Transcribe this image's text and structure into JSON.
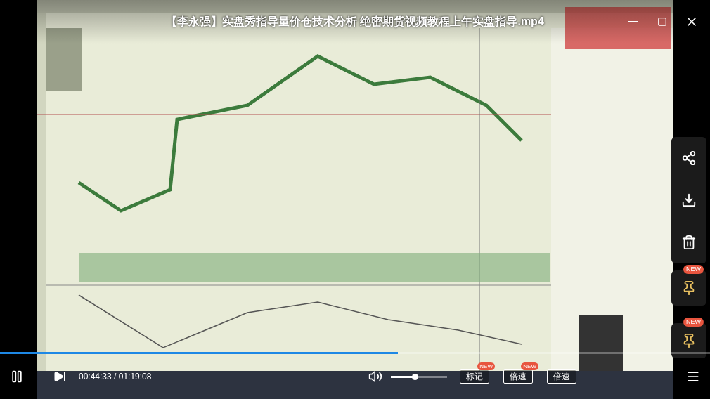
{
  "title": "【李永强】实盘秀指导量价仓技术分析 绝密期货视频教程上午实盘指导.mp4",
  "progress": {
    "level": 0.56
  },
  "controls": {
    "playing": true,
    "time": "00:44:33 / 01:19:08",
    "volume": {
      "level": 0.42
    },
    "buttons": [
      {
        "label": "标记",
        "badge": "NEW"
      },
      {
        "label": "倍速",
        "badge": "NEW"
      },
      {
        "label": "倍速"
      }
    ]
  },
  "side_actions": [
    {
      "kind": "share"
    },
    {
      "kind": "download"
    },
    {
      "kind": "delete"
    }
  ],
  "pins": [
    {
      "badge": "NEW"
    },
    {
      "badge": "NEW"
    }
  ]
}
